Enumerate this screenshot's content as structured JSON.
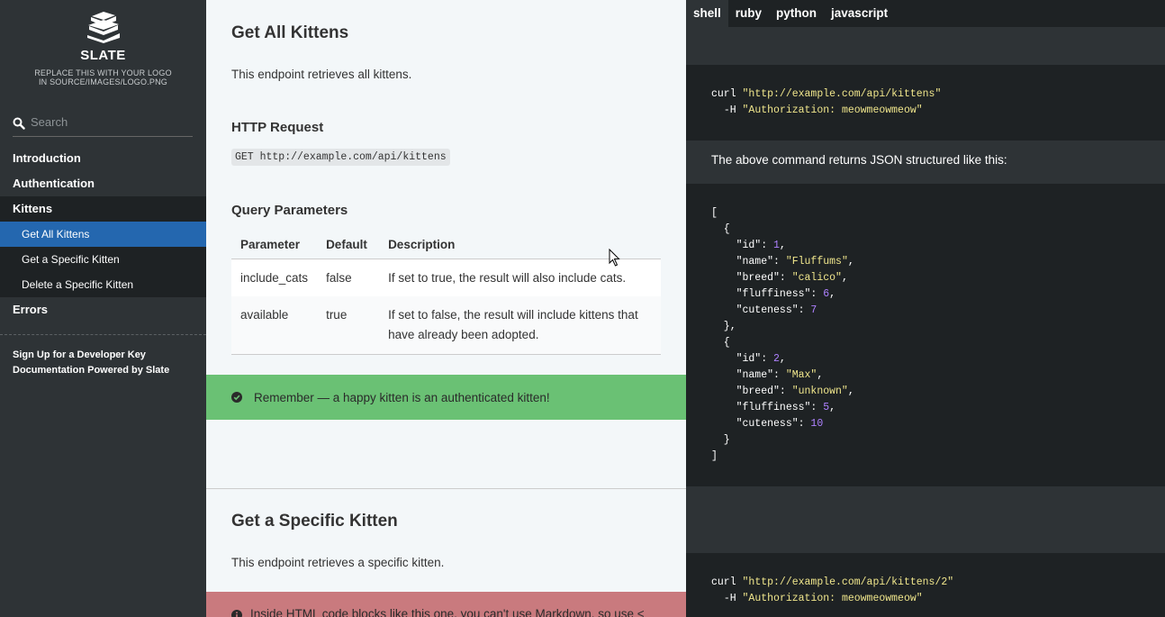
{
  "sidebar": {
    "logo_title": "SLATE",
    "logo_subtitle_line1": "REPLACE THIS WITH YOUR LOGO",
    "logo_subtitle_line2": "IN SOURCE/IMAGES/LOGO.PNG",
    "search_placeholder": "Search",
    "toc": {
      "introduction": "Introduction",
      "authentication": "Authentication",
      "kittens": "Kittens",
      "get_all_kittens": "Get All Kittens",
      "get_specific_kitten": "Get a Specific Kitten",
      "delete_specific_kitten": "Delete a Specific Kitten",
      "errors": "Errors"
    },
    "footer": {
      "signup": "Sign Up for a Developer Key",
      "powered": "Documentation Powered by Slate"
    }
  },
  "main": {
    "get_all_title": "Get All Kittens",
    "get_all_desc": "This endpoint retrieves all kittens.",
    "http_request_heading": "HTTP Request",
    "http_request_code": "GET http://example.com/api/kittens",
    "query_params_heading": "Query Parameters",
    "table": {
      "headers": [
        "Parameter",
        "Default",
        "Description"
      ],
      "rows": [
        [
          "include_cats",
          "false",
          "If set to true, the result will also include cats."
        ],
        [
          "available",
          "true",
          "If set to false, the result will include kittens that have already been adopted."
        ]
      ]
    },
    "success_notice": "Remember — a happy kitten is an authenticated kitten!",
    "get_specific_title": "Get a Specific Kitten",
    "get_specific_desc": "This endpoint retrieves a specific kitten.",
    "warning_notice": "Inside HTML code blocks like this one, you can't use Markdown, so use <"
  },
  "code_panel": {
    "tabs": [
      "shell",
      "ruby",
      "python",
      "javascript"
    ],
    "active_tab": "shell",
    "curl_cmd": "curl",
    "curl_url_1": "\"http://example.com/api/kittens\"",
    "header_flag": "-H",
    "auth_header": "\"Authorization: meowmeowmeow\"",
    "caption": "The above command returns JSON structured like this:",
    "json": {
      "open_bracket": "[",
      "close_bracket": "]",
      "kittens": [
        {
          "id": "1",
          "name": "\"Fluffums\"",
          "breed": "\"calico\"",
          "fluffiness": "6",
          "cuteness": "7"
        },
        {
          "id": "2",
          "name": "\"Max\"",
          "breed": "\"unknown\"",
          "fluffiness": "5",
          "cuteness": "10"
        }
      ]
    },
    "curl_url_2": "\"http://example.com/api/kittens/2\""
  },
  "colors": {
    "sidebar_bg": "#2e3336",
    "active_item": "#2467af",
    "success": "#6ac174",
    "warning": "#c97a7e",
    "string": "#f0e68c",
    "number": "#ae81ff"
  },
  "icons": [
    "books-logo-icon",
    "search-icon",
    "check-circle-icon",
    "info-circle-icon",
    "mouse-cursor-icon"
  ]
}
